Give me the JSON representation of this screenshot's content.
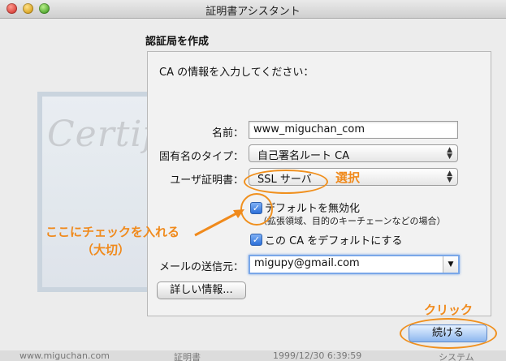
{
  "window": {
    "title": "証明書アシスタント"
  },
  "background": {
    "certificate_word": "Certificate"
  },
  "section": {
    "heading": "認証局を作成",
    "intro": "CA の情報を入力してください："
  },
  "form": {
    "name_label": "名前：",
    "name_value": "www_miguchan_com",
    "identity_type_label": "固有名のタイプ：",
    "identity_type_value": "自己署名ルート CA",
    "user_cert_label": "ユーザ証明書：",
    "user_cert_value": "SSL サーバ",
    "override_defaults_label": "デフォルトを無効化",
    "override_defaults_note": "（拡張領域、目的のキーチェーンなどの場合）",
    "make_default_label": "この CA をデフォルトにする",
    "email_label": "メールの送信元：",
    "email_value": "migupy@gmail.com",
    "learn_more_button": "詳しい情報...",
    "continue_button": "続ける"
  },
  "annotations": {
    "select": "選択",
    "check_here": "ここにチェックを入れる",
    "important": "（大切）",
    "click": "クリック"
  },
  "background_list": {
    "row_text_1": "www.miguchan.com",
    "row_text_2": "証明書",
    "row_text_3": "1999/12/30 6:39:59",
    "row_text_4": "システム"
  },
  "colors": {
    "annotation": "#f08a1c",
    "focus": "#7aa7e8"
  },
  "icons": {
    "check": "✓",
    "popup_arrows": "▲▼",
    "dropdown": "▼"
  }
}
